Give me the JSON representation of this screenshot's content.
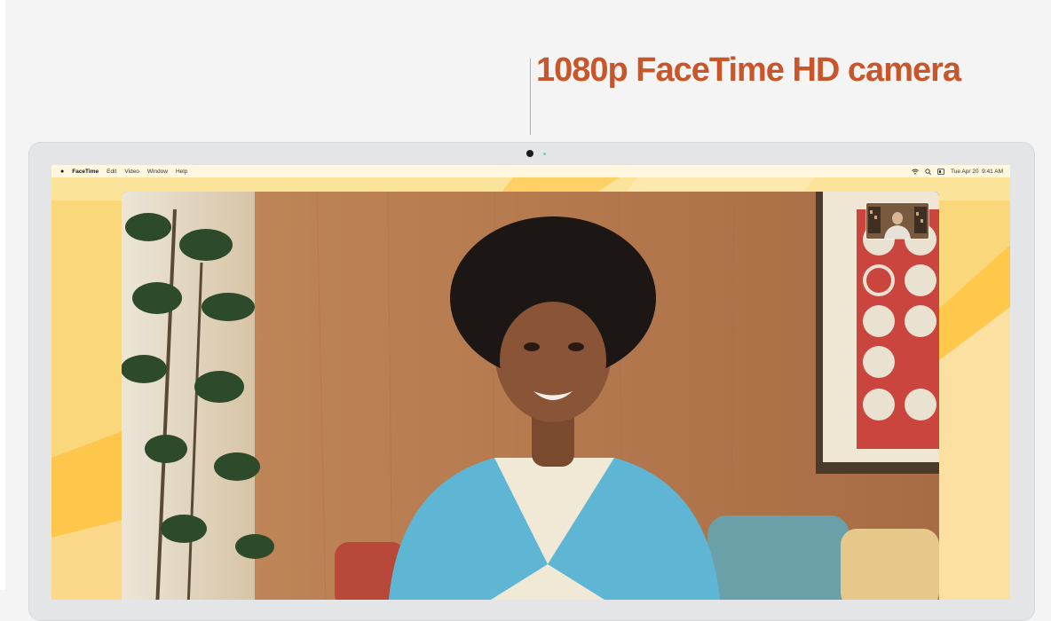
{
  "headline": "1080p FaceTime HD camera",
  "colors": {
    "headline": "#c8562a",
    "wallpaper": "#f9d77a",
    "sweater": "#5fb6d4"
  },
  "menubar": {
    "apple_icon": "apple-logo-icon",
    "app_name": "FaceTime",
    "items": [
      "Edit",
      "Video",
      "Window",
      "Help"
    ],
    "status_icons": [
      "wifi-icon",
      "search-icon",
      "control-center-icon"
    ],
    "datetime": "Tue Apr 20  9:41 AM"
  },
  "facetime": {
    "main_video": "remote-participant-video",
    "self_view": "self-view-thumbnail"
  }
}
